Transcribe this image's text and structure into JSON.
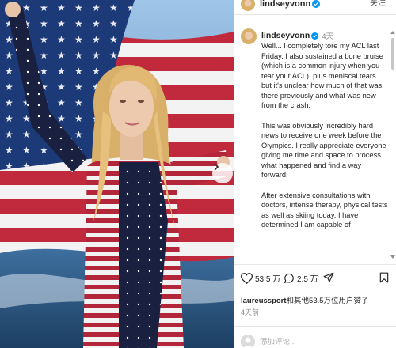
{
  "header": {
    "username": "lindseyvonn",
    "follow_label": "关注",
    "avatar_icon": "profile-photo-icon",
    "verified_icon": "verified-badge-icon"
  },
  "caption": {
    "username": "lindseyvonn",
    "time": "4天",
    "paragraphs": [
      "Well... I completely tore my ACL last Friday. I also sustained a bone bruise (which is a common injury when you tear your ACL), plus meniscal tears but it's unclear how much of that was there previously and what was new from the crash.",
      "This was obviously incredibly hard news to receive one week before the Olympics. I really appreciate everyone giving me time and space to process what happened and find a way forward.",
      "After extensive consultations with doctors, intense therapy, physical tests as well as skiing today, I have determined I am capable of"
    ]
  },
  "actions": {
    "likes": "53.5 万",
    "comments": "2.5 万",
    "like_icon": "heart-icon",
    "comment_icon": "comment-bubble-icon",
    "share_icon": "paper-plane-icon",
    "save_icon": "bookmark-icon"
  },
  "liked_by": {
    "user": "laureussport",
    "rest": "和其他53.5万位用户赞了"
  },
  "post_time": "4天前",
  "comment": {
    "placeholder": "添加评论..."
  },
  "colors": {
    "flag_red": "#b8283a",
    "flag_blue": "#1d3a78",
    "sky": "#8fb4d8"
  }
}
